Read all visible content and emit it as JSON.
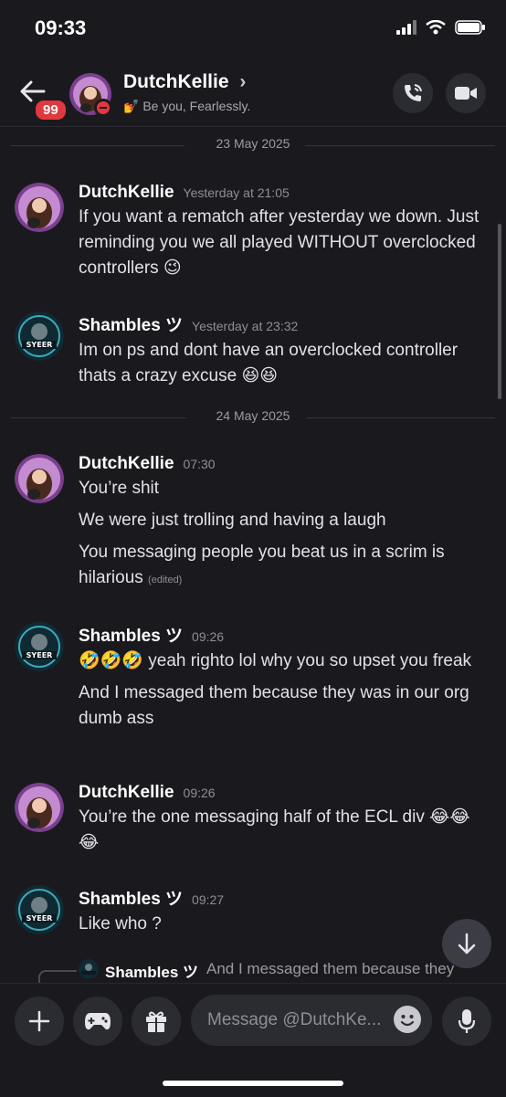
{
  "status_bar": {
    "time": "09:33"
  },
  "header": {
    "unread_badge": "99",
    "name": "DutchKellie",
    "chevron": "›",
    "status": "💅 Be you, Fearlessly.",
    "buttons": [
      "phone-call-icon",
      "video-call-icon"
    ]
  },
  "dates": [
    "23 May 2025",
    "24 May 2025"
  ],
  "messages": [
    {
      "user": "DutchKellie",
      "time": "Yesterday at 21:05",
      "lines": [
        "If you want a rematch after yesterday we down. Just reminding you we all played WITHOUT overclocked controllers 😉"
      ]
    },
    {
      "user": "Shambles ツ",
      "time": "Yesterday at 23:32",
      "lines": [
        "Im on ps and dont have an overclocked controller thats a crazy excuse 😆😆"
      ]
    },
    {
      "user": "DutchKellie",
      "time": "07:30",
      "lines": [
        "You’re shit",
        "We were just trolling and having a laugh",
        "You messaging people you beat us in a scrim is hilarious"
      ],
      "edited": "(edited)"
    },
    {
      "user": "Shambles ツ",
      "time": "09:26",
      "lines": [
        "🤣🤣🤣 yeah righto lol why you so upset you freak",
        "And I messaged them because they was in our org dumb ass"
      ]
    },
    {
      "user": "DutchKellie",
      "time": "09:26",
      "lines": [
        "You’re the one messaging half of the ECL div 😂😂😂"
      ]
    },
    {
      "user": "Shambles ツ",
      "time": "09:27",
      "lines": [
        "Like who ?"
      ]
    }
  ],
  "reply_preview": {
    "user": "Shambles ツ",
    "text": "And I messaged them because they"
  },
  "composer": {
    "placeholder": "Message @DutchKe..."
  },
  "colors": {
    "background": "#1a1a1e",
    "badge": "#e0383e",
    "button_bg": "#2b2b32"
  }
}
